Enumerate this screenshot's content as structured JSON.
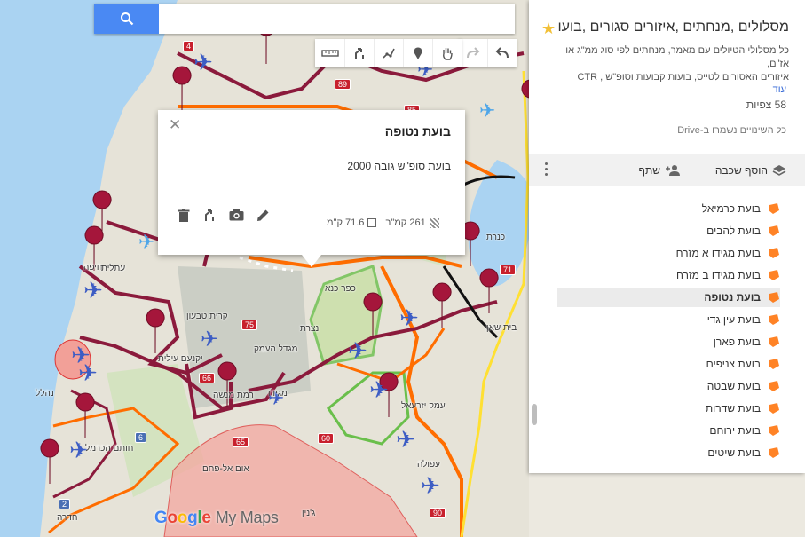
{
  "search": {
    "placeholder": "",
    "value": ""
  },
  "popup": {
    "title": "בועת נטופה",
    "description": "בועת סופ\"ש גובה 2000",
    "area": "261 קמ\"ר",
    "perimeter": "71.6 ק\"מ"
  },
  "panel": {
    "title": "מסלולים ,מנחתים ,איזורים סגורים ,בועו...",
    "description_line1": "כל מסלולי הטיולים עם מאמר, מנחתים לפי סוג ממ\"ג או אז\"ם,",
    "description_line2": "איזורים האסורים לטייס, בועות קבועות וסופ\"ש , CTR",
    "more_link": "עוד",
    "views": "58 צפיות",
    "saved_status": "כל השינויים נשמרו ב-Drive",
    "add_layer_label": "הוסף שכבה",
    "share_label": "שתף"
  },
  "layers": [
    {
      "label": "בועת כרמיאל"
    },
    {
      "label": "בועת להבים"
    },
    {
      "label": "בועת מגידו א מזרח"
    },
    {
      "label": "בועת מגידו ב מזרח"
    },
    {
      "label": "בועת נטופה",
      "active": true
    },
    {
      "label": "בועת עין גדי"
    },
    {
      "label": "בועת פארן"
    },
    {
      "label": "בועת צניפים"
    },
    {
      "label": "בועת שבטה"
    },
    {
      "label": "בועת שדרות"
    },
    {
      "label": "בועת ירוחם"
    },
    {
      "label": "בועת שיטים"
    }
  ],
  "map_labels": {
    "haifa": "חיפה",
    "yokneam": "יקנעם עילית",
    "nazareth": "נצרת",
    "kafr_kanna": "כפר כנא",
    "tiberias_lake": "כנרת",
    "afula": "עפולה",
    "migdal_haemek": "מגדל העמק",
    "megiddo": "מגידו",
    "um_al_fahm": "אום אל-פחם",
    "jenin": "ג'נין",
    "tivon": "קרית טבעון",
    "beit_shean": "בית שאן",
    "hadera": "חדרה",
    "yizrael": "עמק יזרעאל",
    "ramat_menashe": "רמת מנשה",
    "atlit": "עתלית",
    "carmel": "חותם הכרמל",
    "nahalal": "נהלל"
  },
  "road_numbers": [
    "4",
    "89",
    "85",
    "75",
    "66",
    "6",
    "60",
    "65",
    "71",
    "90",
    "2"
  ],
  "logo": {
    "google": "Google",
    "product": "My Maps"
  },
  "colors": {
    "accent": "#4a89f3",
    "route_dark": "#8b1a3c",
    "route_orange": "#ff6d00",
    "restricted": "#f28b82",
    "bubble_green": "#6abf4b",
    "pin": "#a5163b"
  }
}
